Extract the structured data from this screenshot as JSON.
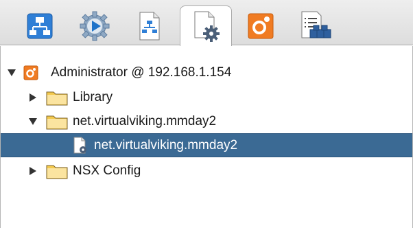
{
  "tabs": [
    {
      "name": "tab-workflows",
      "icon": "workflow-icon"
    },
    {
      "name": "tab-executions",
      "icon": "gear-play-icon"
    },
    {
      "name": "tab-actions",
      "icon": "document-flow-icon"
    },
    {
      "name": "tab-configurations",
      "icon": "document-gear-icon",
      "active": true
    },
    {
      "name": "tab-resources",
      "icon": "orange-resource-icon"
    },
    {
      "name": "tab-packages",
      "icon": "list-package-icon"
    }
  ],
  "tree": {
    "root_label": "Administrator @ 192.168.1.154",
    "items": [
      {
        "label": "Library"
      },
      {
        "label": "net.virtualviking.mmday2"
      },
      {
        "label": "net.virtualviking.mmday2"
      },
      {
        "label": "NSX Config"
      }
    ]
  },
  "colors": {
    "selection": "#3b6a94",
    "folder": "#f3c94d",
    "orange_root": "#f07b22",
    "tab_blue": "#2f7fd6"
  }
}
